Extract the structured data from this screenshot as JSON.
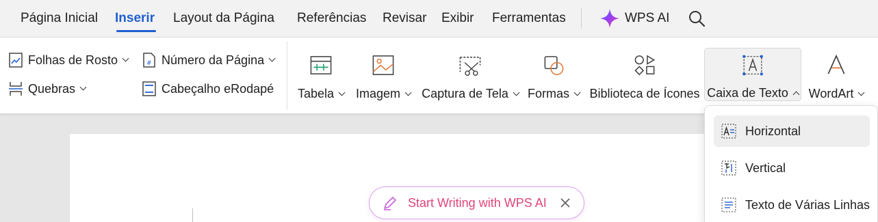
{
  "menu": {
    "items": [
      {
        "label": "Página Inicial"
      },
      {
        "label": "Inserir",
        "active": true
      },
      {
        "label": "Layout da Página"
      },
      {
        "label": "Referências"
      },
      {
        "label": "Revisar"
      },
      {
        "label": "Exibir"
      },
      {
        "label": "Ferramentas"
      }
    ],
    "wps_ai_label": "WPS AI",
    "search_icon": "search-icon"
  },
  "ribbon": {
    "small": {
      "cover_pages": "Folhas de Rosto",
      "page_number": "Número da Página",
      "breaks": "Quebras",
      "header_footer": "Cabeçalho eRodapé"
    },
    "big": {
      "table": "Tabela",
      "image": "Imagem",
      "screenshot": "Captura de Tela",
      "shapes": "Formas",
      "icon_library": "Biblioteca de Ícones",
      "text_box": "Caixa de Texto",
      "wordart": "WordArt"
    }
  },
  "text_box_menu": {
    "items": [
      {
        "label": "Horizontal",
        "icon": "horizontal-textbox-icon"
      },
      {
        "label": "Vertical",
        "icon": "vertical-textbox-icon"
      },
      {
        "label": "Texto de Várias Linhas",
        "icon": "multiline-textbox-icon"
      }
    ]
  },
  "ai_prompt": {
    "label": "Start Writing with WPS AI"
  },
  "colors": {
    "accent": "#1f5fd1",
    "ai_pink": "#e0457b",
    "ai_purple": "#7a3cf0"
  }
}
